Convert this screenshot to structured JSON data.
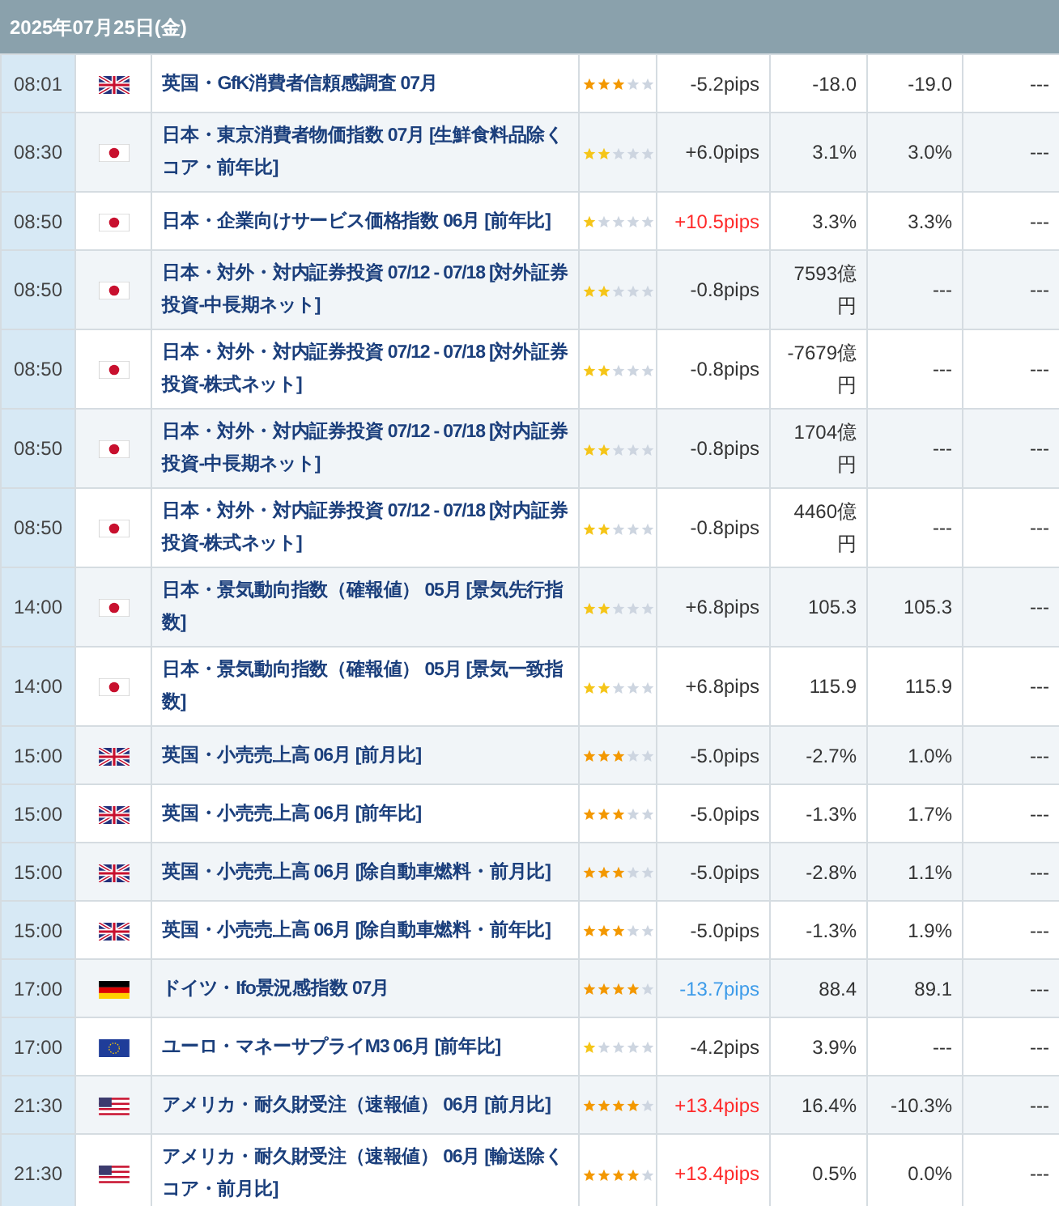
{
  "header": {
    "date": "2025年07月25日(金)"
  },
  "rows": [
    {
      "time": "08:01",
      "kind": "uk",
      "event": "英国・GfK消費者信頼感調査 07月",
      "stars": 3,
      "pips": "-5.2pips",
      "color": "#333333",
      "column_5": "-18.0",
      "column_6": "-19.0",
      "column_7": "---"
    },
    {
      "time": "08:30",
      "kind": "jp",
      "event": "日本・東京消費者物価指数 07月 [生鮮食料品除くコア・前年比]",
      "stars": 2,
      "pips": "+6.0pips",
      "color": "#333333",
      "column_5": "3.1%",
      "column_6": "3.0%",
      "column_7": "---"
    },
    {
      "time": "08:50",
      "kind": "jp",
      "event": "日本・企業向けサービス価格指数 06月 [前年比]",
      "stars": 1,
      "pips": "+10.5pips",
      "color": "#ff2a2a",
      "column_5": "3.3%",
      "column_6": "3.3%",
      "column_7": "---"
    },
    {
      "time": "08:50",
      "kind": "jp",
      "event": "日本・対外・対内証券投資 07/12 - 07/18 [対外証券投資-中長期ネット]",
      "stars": 2,
      "pips": "-0.8pips",
      "color": "#333333",
      "column_5": "7593億円",
      "column_6": "---",
      "column_7": "---"
    },
    {
      "time": "08:50",
      "kind": "jp",
      "event": "日本・対外・対内証券投資 07/12 - 07/18 [対外証券投資-株式ネット]",
      "stars": 2,
      "pips": "-0.8pips",
      "color": "#333333",
      "column_5": "-7679億円",
      "column_6": "---",
      "column_7": "---"
    },
    {
      "time": "08:50",
      "kind": "jp",
      "event": "日本・対外・対内証券投資 07/12 - 07/18 [対内証券投資-中長期ネット]",
      "stars": 2,
      "pips": "-0.8pips",
      "color": "#333333",
      "column_5": "1704億円",
      "column_6": "---",
      "column_7": "---"
    },
    {
      "time": "08:50",
      "kind": "jp",
      "event": "日本・対外・対内証券投資 07/12 - 07/18 [対内証券投資-株式ネット]",
      "stars": 2,
      "pips": "-0.8pips",
      "color": "#333333",
      "column_5": "4460億円",
      "column_6": "---",
      "column_7": "---"
    },
    {
      "time": "14:00",
      "kind": "jp",
      "event": "日本・景気動向指数（確報値） 05月 [景気先行指数]",
      "stars": 2,
      "pips": "+6.8pips",
      "color": "#333333",
      "column_5": "105.3",
      "column_6": "105.3",
      "column_7": "---"
    },
    {
      "time": "14:00",
      "kind": "jp",
      "event": "日本・景気動向指数（確報値） 05月 [景気一致指数]",
      "stars": 2,
      "pips": "+6.8pips",
      "color": "#333333",
      "column_5": "115.9",
      "column_6": "115.9",
      "column_7": "---"
    },
    {
      "time": "15:00",
      "kind": "uk",
      "event": "英国・小売売上高 06月 [前月比]",
      "stars": 3,
      "pips": "-5.0pips",
      "color": "#333333",
      "column_5": "-2.7%",
      "column_6": "1.0%",
      "column_7": "---"
    },
    {
      "time": "15:00",
      "kind": "uk",
      "event": "英国・小売売上高 06月 [前年比]",
      "stars": 3,
      "pips": "-5.0pips",
      "color": "#333333",
      "column_5": "-1.3%",
      "column_6": "1.7%",
      "column_7": "---"
    },
    {
      "time": "15:00",
      "kind": "uk",
      "event": "英国・小売売上高 06月 [除自動車燃料・前月比]",
      "stars": 3,
      "pips": "-5.0pips",
      "color": "#333333",
      "column_5": "-2.8%",
      "column_6": "1.1%",
      "column_7": "---"
    },
    {
      "time": "15:00",
      "kind": "uk",
      "event": "英国・小売売上高 06月 [除自動車燃料・前年比]",
      "stars": 3,
      "pips": "-5.0pips",
      "color": "#333333",
      "column_5": "-1.3%",
      "column_6": "1.9%",
      "column_7": "---"
    },
    {
      "time": "17:00",
      "kind": "de",
      "event": "ドイツ・Ifo景況感指数 07月",
      "stars": 4,
      "pips": "-13.7pips",
      "color": "#3d9be9",
      "column_5": "88.4",
      "column_6": "89.1",
      "column_7": "---"
    },
    {
      "time": "17:00",
      "kind": "eu",
      "event": "ユーロ・マネーサプライM3 06月 [前年比]",
      "stars": 1,
      "pips": "-4.2pips",
      "color": "#333333",
      "column_5": "3.9%",
      "column_6": "---",
      "column_7": "---"
    },
    {
      "time": "21:30",
      "kind": "us",
      "event": "アメリカ・耐久財受注（速報値） 06月 [前月比]",
      "stars": 4,
      "pips": "+13.4pips",
      "color": "#ff2a2a",
      "column_5": "16.4%",
      "column_6": "-10.3%",
      "column_7": "---"
    },
    {
      "time": "21:30",
      "kind": "us",
      "event": "アメリカ・耐久財受注（速報値） 06月 [輸送除くコア・前月比]",
      "stars": 4,
      "pips": "+13.4pips",
      "color": "#ff2a2a",
      "column_5": "0.5%",
      "column_6": "0.0%",
      "column_7": "---"
    }
  ]
}
